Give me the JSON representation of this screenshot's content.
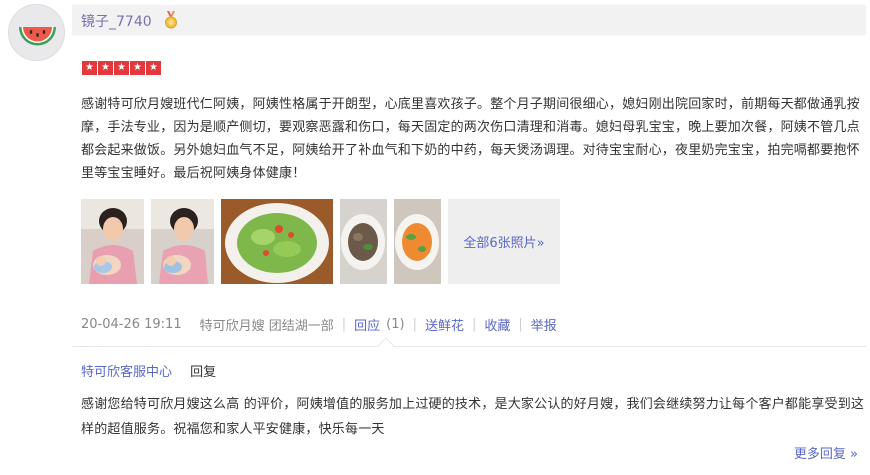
{
  "user": {
    "avatar_icon": "watermelon-avatar-icon",
    "name": "镜子_7740",
    "badge_icon": "medal-icon"
  },
  "rating": {
    "stars": 5,
    "max": 5,
    "color": "#e4393c"
  },
  "review": {
    "text": "感谢特可欣月嫂班代仁阿姨，阿姨性格属于开朗型，心底里喜欢孩子。整个月子期间很细心，媳妇刚出院回家时，前期每天都做通乳按摩，手法专业，因为是顺产侧切，要观察恶露和伤口，每天固定的两次伤口清理和消毒。媳妇母乳宝宝，晚上要加次餐，阿姨不管几点都会起来做饭。另外媳妇血气不足，阿姨给开了补血气和下奶的中药，每天煲汤调理。对待宝宝耐心，夜里奶完宝宝，拍完嗝都要抱怀里等宝宝睡好。最后祝阿姨身体健康！"
  },
  "photos": {
    "items": [
      {
        "name": "photo-woman-with-baby-1"
      },
      {
        "name": "photo-woman-with-baby-2"
      },
      {
        "name": "photo-vegetable-salad"
      },
      {
        "name": "photo-meat-dish"
      },
      {
        "name": "photo-carrot-dish"
      }
    ],
    "all_label": "全部6张照片»"
  },
  "meta": {
    "date": "20-04-26 19:11",
    "source": "特可欣月嫂 团结湖一部",
    "reply_label": "回应",
    "reply_count": "(1)",
    "flower_label": "送鲜花",
    "favorite_label": "收藏",
    "report_label": "举报"
  },
  "reply": {
    "author": "特可欣客服中心",
    "label": "回复",
    "text": "感谢您给特可欣月嫂这么高 的评价，阿姨增值的服务加上过硬的技术，是大家公认的好月嫂，我们会继续努力让每个客户都能享受到这样的超值服务。祝福您和家人平安健康，快乐每一天",
    "more_label": "更多回复 »"
  },
  "colors": {
    "link": "#5a67c8",
    "username": "#7b6fb0",
    "meta_gray": "#888888",
    "userbar_bg": "#f2f2f2"
  }
}
